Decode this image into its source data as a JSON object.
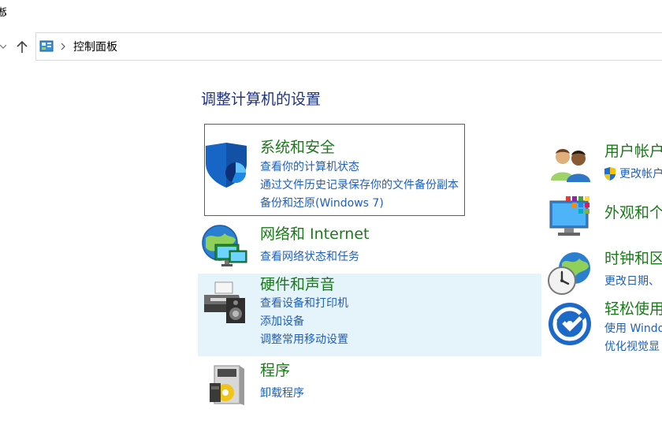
{
  "window": {
    "title_fragment": "板"
  },
  "address_bar": {
    "path": "控制面板"
  },
  "main": {
    "heading": "调整计算机的设置",
    "categories_left": [
      {
        "title": "系统和安全",
        "icon": "shield-icon",
        "links": [
          "查看你的计算机状态",
          "通过文件历史记录保存你的文件备份副本",
          "备份和还原(Windows 7)"
        ]
      },
      {
        "title": "网络和 Internet",
        "icon": "network-globe-icon",
        "links": [
          "查看网络状态和任务"
        ]
      },
      {
        "title": "硬件和声音",
        "icon": "printer-speaker-icon",
        "links": [
          "查看设备和打印机",
          "添加设备",
          "调整常用移动设置"
        ]
      },
      {
        "title": "程序",
        "icon": "programs-box-icon",
        "links": [
          "卸载程序"
        ]
      }
    ],
    "categories_right": [
      {
        "title": "用户帐户",
        "icon": "users-icon",
        "links": [
          "更改帐户"
        ]
      },
      {
        "title": "外观和个",
        "icon": "appearance-monitor-icon",
        "links": []
      },
      {
        "title": "时钟和区",
        "icon": "clock-globe-icon",
        "links": [
          "更改日期、"
        ]
      },
      {
        "title": "轻松使用",
        "icon": "ease-of-access-icon",
        "links": [
          "使用 Windo",
          "优化视觉显"
        ]
      }
    ]
  }
}
